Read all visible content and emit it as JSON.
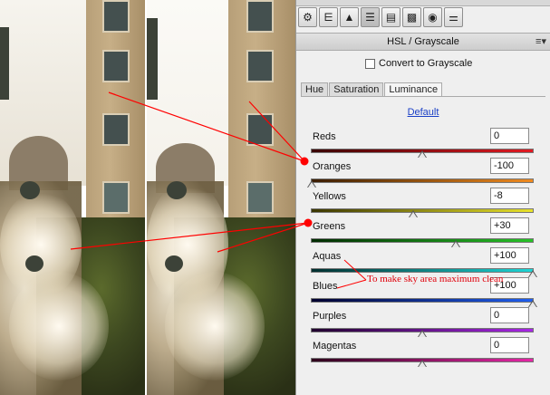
{
  "panel": {
    "section_title": "HSL / Grayscale",
    "menu_icon": "panel-menu-icon",
    "convert_label": "Convert to Grayscale",
    "convert_checked": false,
    "tabs": [
      {
        "label": "Hue",
        "active": false
      },
      {
        "label": "Saturation",
        "active": false
      },
      {
        "label": "Luminance",
        "active": true
      }
    ],
    "default_label": "Default",
    "toolbar_icons": [
      "basic-icon",
      "tone-curve-icon",
      "detail-icon",
      "hsl-icon",
      "split-toning-icon",
      "lens-corrections-icon",
      "camera-calibration-icon",
      "presets-icon"
    ]
  },
  "sliders": [
    {
      "label": "Reds",
      "value": "0",
      "level": 0
    },
    {
      "label": "Oranges",
      "value": "-100",
      "level": -100
    },
    {
      "label": "Yellows",
      "value": "-8",
      "level": -8
    },
    {
      "label": "Greens",
      "value": "+30",
      "level": 30
    },
    {
      "label": "Aquas",
      "value": "+100",
      "level": 100
    },
    {
      "label": "Blues",
      "value": "+100",
      "level": 100
    },
    {
      "label": "Purples",
      "value": "0",
      "level": 0
    },
    {
      "label": "Magentas",
      "value": "0",
      "level": 0
    }
  ],
  "annotation": {
    "text": "To make sky area maximum clean",
    "color": "#e0000b"
  },
  "colors": {
    "annotation_red": "#ff0000",
    "link_blue": "#1a3fc6"
  }
}
